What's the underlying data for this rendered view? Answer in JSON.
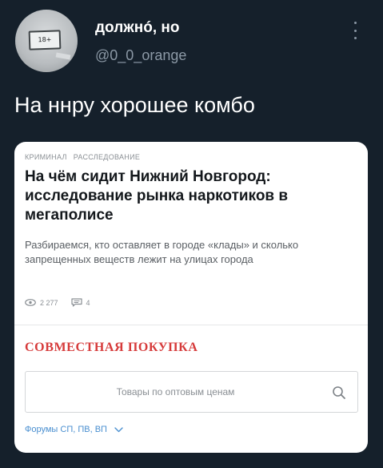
{
  "tweet": {
    "display_name": "должнó, но",
    "handle": "@0_0_orange",
    "avatar_text": "18+",
    "text": "На ннру хорошее комбо"
  },
  "card": {
    "tags": [
      "КРИМИНАЛ",
      "РАССЛЕДОВАНИЕ"
    ],
    "title": "На чём сидит Нижний Новгород: исследование рынка наркотиков в мегаполисе",
    "description": "Разбираемся, кто оставляет в городе «клады» и сколько запрещенных веществ лежит на улицах города",
    "stats": {
      "views": "2 277",
      "comments": "4"
    },
    "section_title": "СОВМЕСТНАЯ ПОКУПКА",
    "search": {
      "placeholder": "Товары по оптовым ценам"
    },
    "forums_label": "Форумы СП, ПВ, ВП"
  },
  "colors": {
    "background": "#15202b",
    "accent_red": "#d63a3a",
    "link_blue": "#4a8fd0",
    "muted": "#8b98a5"
  },
  "icons": [
    "more-vertical-icon",
    "eye-icon",
    "comment-icon",
    "search-icon",
    "chevron-down-icon"
  ]
}
